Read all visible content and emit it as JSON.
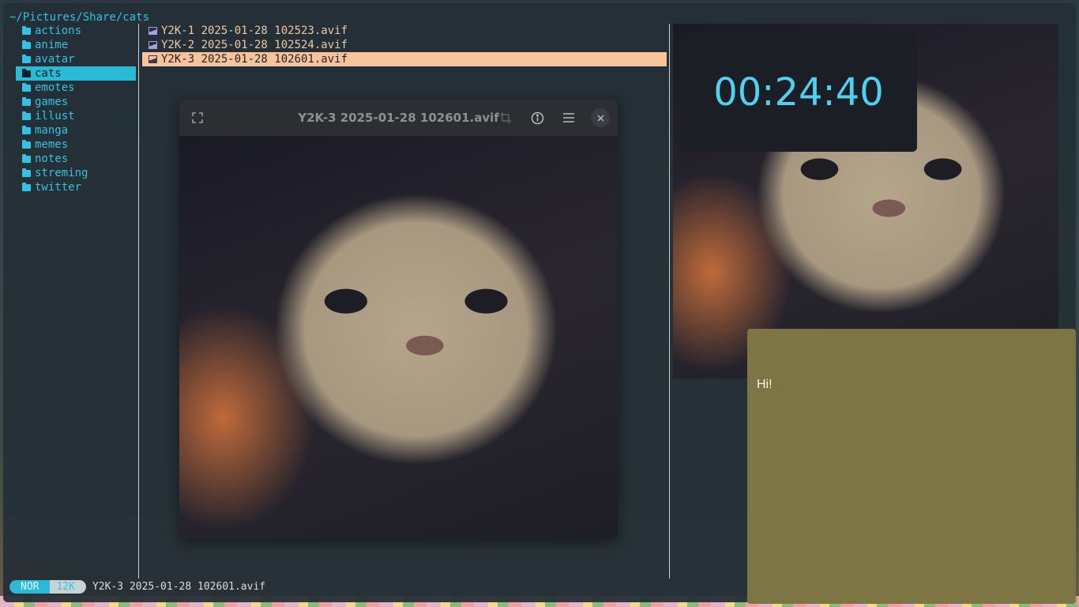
{
  "terminal": {
    "path": "~/Pictures/Share/cats",
    "directories": [
      {
        "label": "actions",
        "selected": false
      },
      {
        "label": "anime",
        "selected": false
      },
      {
        "label": "avatar",
        "selected": false
      },
      {
        "label": "cats",
        "selected": true
      },
      {
        "label": "emotes",
        "selected": false
      },
      {
        "label": "games",
        "selected": false
      },
      {
        "label": "illust",
        "selected": false
      },
      {
        "label": "manga",
        "selected": false
      },
      {
        "label": "memes",
        "selected": false
      },
      {
        "label": "notes",
        "selected": false
      },
      {
        "label": "streming",
        "selected": false
      },
      {
        "label": "twitter",
        "selected": false
      }
    ],
    "files": [
      {
        "label": "Y2K-1 2025-01-28 102523.avif",
        "selected": false
      },
      {
        "label": "Y2K-2 2025-01-28 102524.avif",
        "selected": false
      },
      {
        "label": "Y2K-3 2025-01-28 102601.avif",
        "selected": true
      }
    ],
    "status": {
      "mode": "NOR",
      "size": "12K",
      "filename": "Y2K-3 2025-01-28 102601.avif"
    }
  },
  "viewer": {
    "title": "Y2K-3 2025-01-28 102601.avif",
    "icons": [
      "fullscreen-icon",
      "crop-icon",
      "info-icon",
      "menu-icon",
      "close-icon"
    ]
  },
  "clock": {
    "time": "00:24:40"
  },
  "note": {
    "text": "Hi!"
  },
  "colors": {
    "accent": "#2bbad6",
    "file_selected": "#f8c39a",
    "note_bg": "#7d7644",
    "clock_text": "#4fd1ef"
  }
}
